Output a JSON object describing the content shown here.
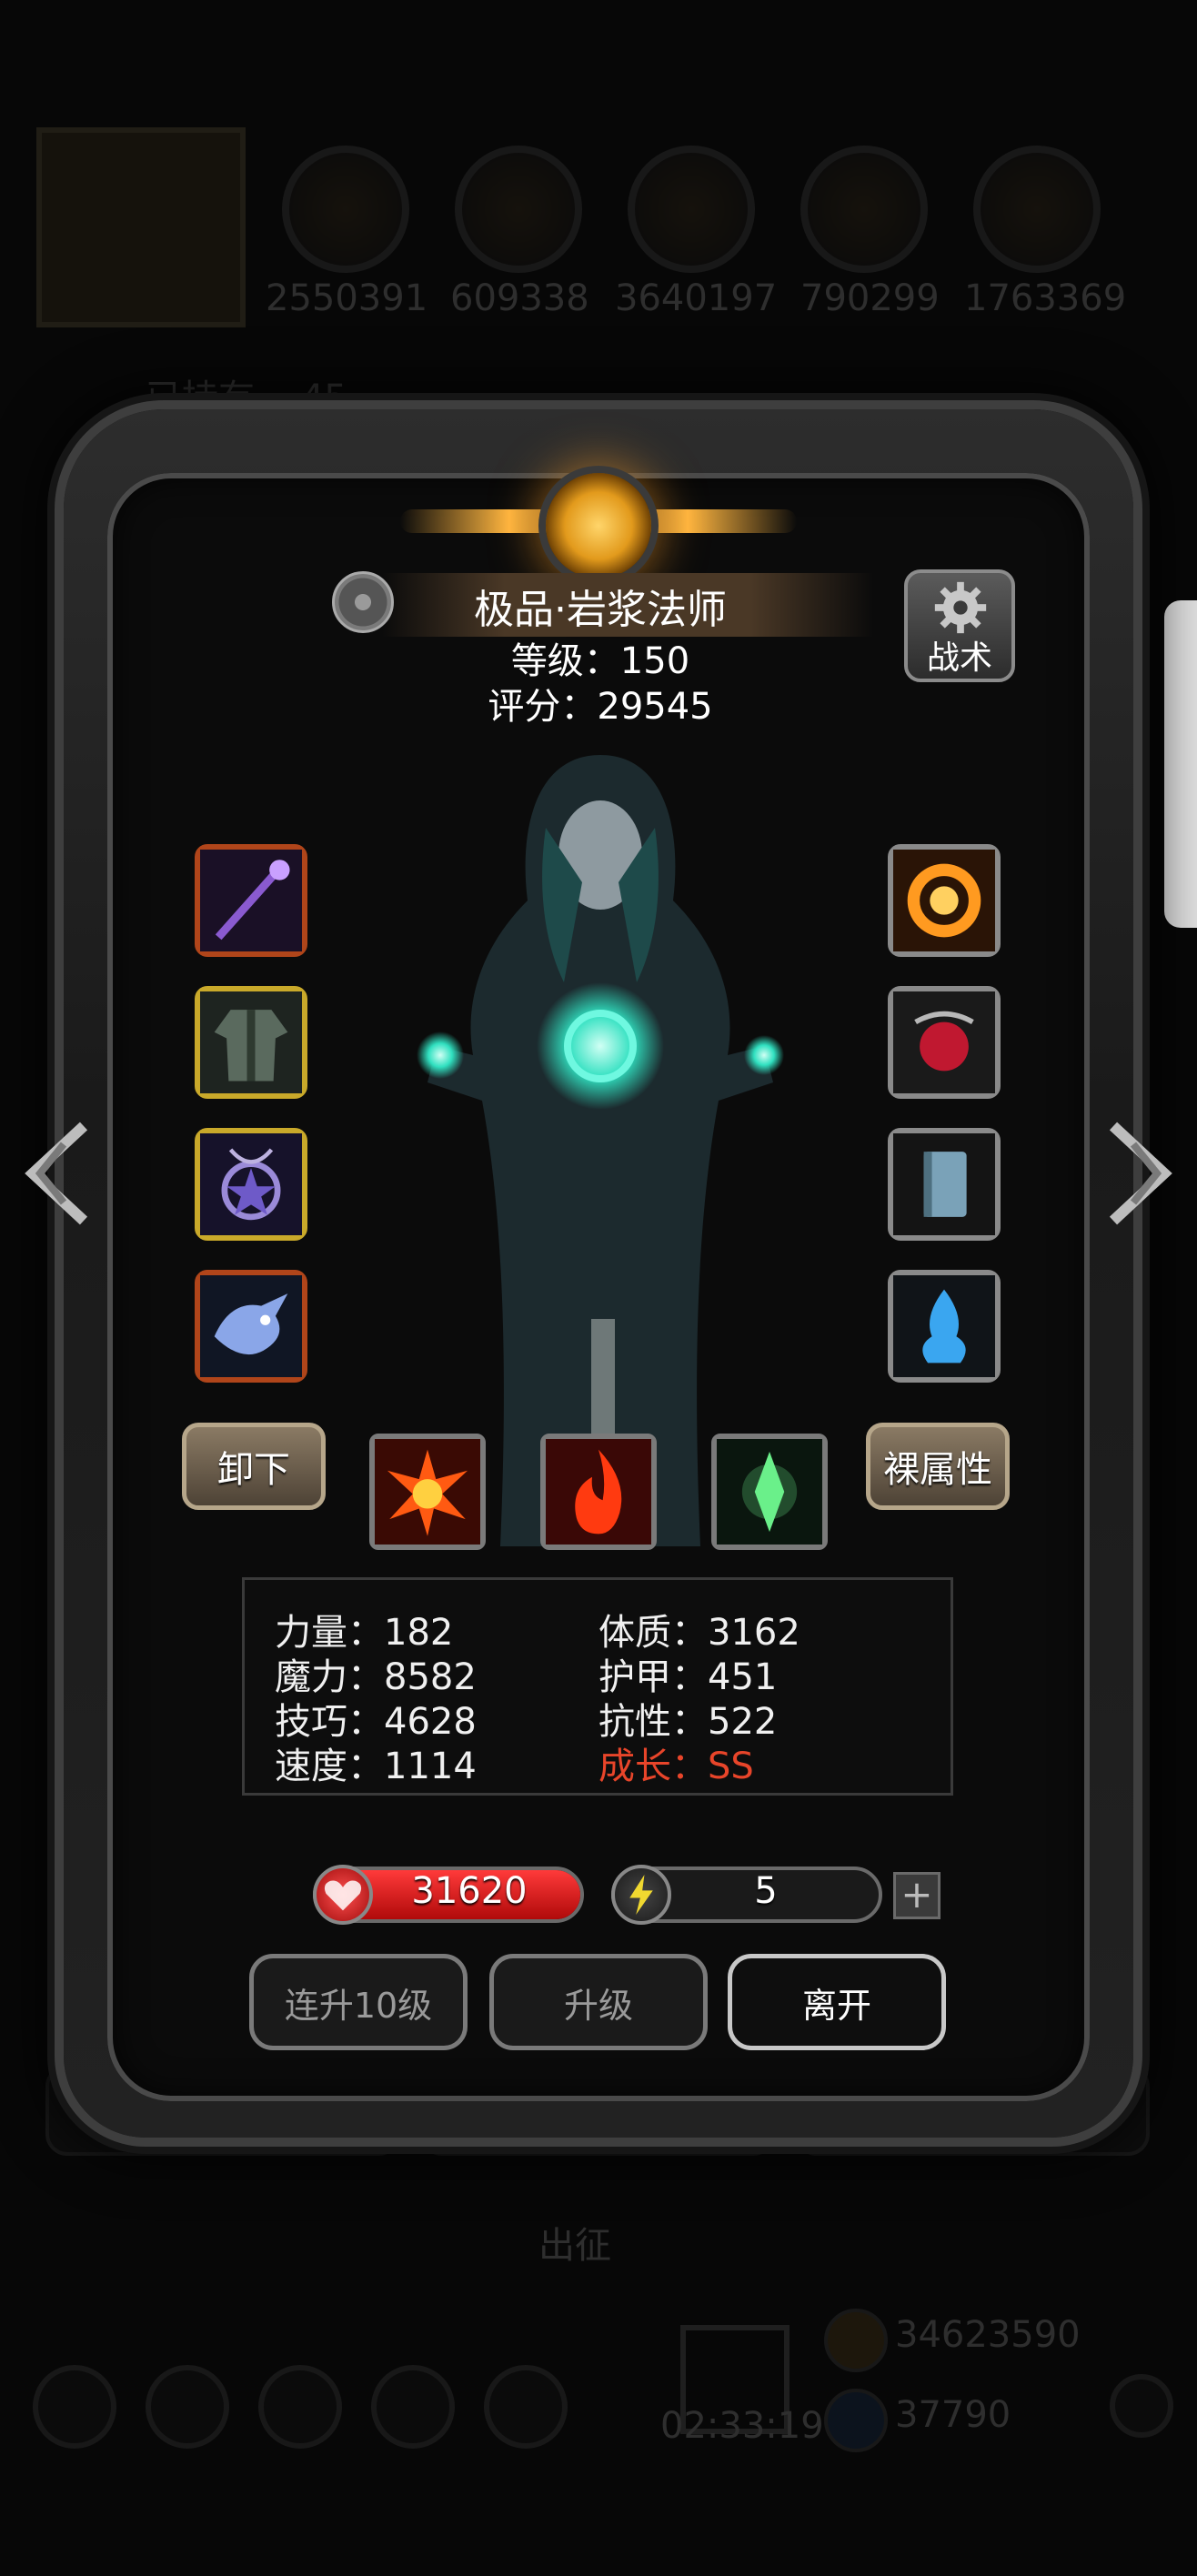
{
  "background": {
    "resources": [
      "2550391",
      "609338",
      "3640197",
      "790299",
      "1763369"
    ],
    "status_text": "已持有... 45",
    "bottom_label": "出征",
    "gold_amount": "34623590",
    "gem_amount": "37790",
    "timer": "02:33:19"
  },
  "hero": {
    "name": "极品·岩浆法师",
    "level_label": "等级：150",
    "score_label": "评分：29545",
    "tactics_label": "战术"
  },
  "buttons": {
    "unequip": "卸下",
    "base_attrs": "裸属性",
    "level_up_10": "连升10级",
    "level_up": "升级",
    "leave": "离开",
    "plus": "+"
  },
  "stats": {
    "strength": "力量：182",
    "magic": "魔力：8582",
    "skill": "技巧：4628",
    "speed": "速度：1114",
    "constitution": "体质：3162",
    "armor": "护甲：451",
    "resistance": "抗性：522",
    "growth": "成长：SS"
  },
  "bars": {
    "hp_value": "31620",
    "hp_fraction": 1.0,
    "energy_value": "5",
    "energy_fraction": 0.12
  },
  "equipment": {
    "left": [
      "staff-icon",
      "robe-icon",
      "amulet-icon",
      "dragon-icon"
    ],
    "right": [
      "fire-ring-icon",
      "red-orb-icon",
      "book-icon",
      "blue-spirit-icon"
    ]
  },
  "gems": [
    "fire-burst-icon",
    "flame-icon",
    "green-crystal-icon"
  ],
  "colors": {
    "growth": "#e8452a",
    "hp": "#d01818",
    "energy": "#d8c83a"
  }
}
